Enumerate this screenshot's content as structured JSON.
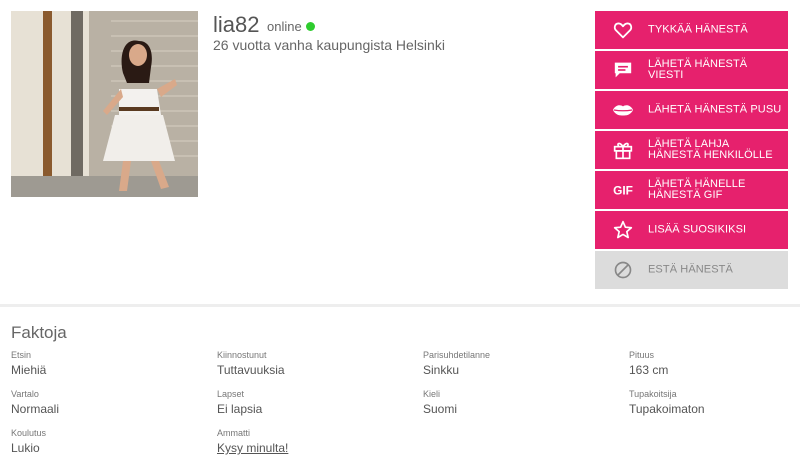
{
  "profile": {
    "username": "lia82",
    "status": "online",
    "status_color": "#2ecc2e",
    "subtitle": "26 vuotta vanha kaupungista Helsinki"
  },
  "actions": [
    {
      "label": "Tykkää hänestä",
      "icon": "heart-icon"
    },
    {
      "label": "Lähetä hänestä viesti",
      "icon": "message-icon"
    },
    {
      "label": "Lähetä hänestä pusu",
      "icon": "lips-icon"
    },
    {
      "label": "Lähetä lahja hänestä henkilölle",
      "icon": "gift-icon"
    },
    {
      "label": "Lähetä hänelle hänestä GIF",
      "icon": "gif-icon"
    },
    {
      "label": "Lisää suosikiksi",
      "icon": "star-icon"
    },
    {
      "label": "Estä hänestä",
      "icon": "block-icon"
    }
  ],
  "colors": {
    "accent": "#e6216d",
    "disabled": "#dcdcdc"
  },
  "facts": {
    "title": "Faktoja",
    "items": [
      {
        "label": "Etsin",
        "value": "Miehiä"
      },
      {
        "label": "Kiinnostunut",
        "value": "Tuttavuuksia"
      },
      {
        "label": "Parisuhdetilanne",
        "value": "Sinkku"
      },
      {
        "label": "Pituus",
        "value": "163 cm"
      },
      {
        "label": "Vartalo",
        "value": "Normaali"
      },
      {
        "label": "Lapset",
        "value": "Ei lapsia"
      },
      {
        "label": "Kieli",
        "value": "Suomi"
      },
      {
        "label": "Tupakoitsija",
        "value": "Tupakoimaton"
      },
      {
        "label": "Koulutus",
        "value": "Lukio"
      },
      {
        "label": "Ammatti",
        "value": "Kysy minulta!"
      }
    ]
  }
}
